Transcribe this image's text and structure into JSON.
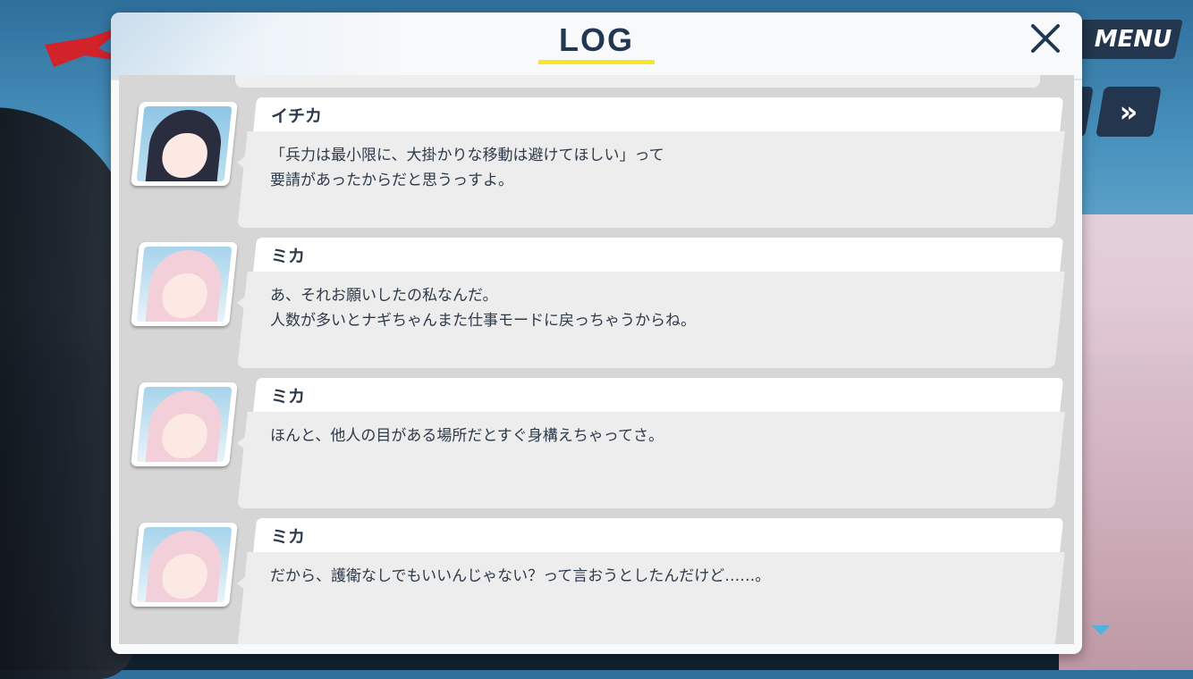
{
  "dialog": {
    "title": "LOG"
  },
  "hud": {
    "menu_label": "MENU",
    "fast_forward_label": "»"
  },
  "entries": [
    {
      "speaker": "イチカ",
      "avatar": "ichika-portrait",
      "text": "「兵力は最小限に、大掛かりな移動は避けてほしい」って\n要請があったからだと思うっすよ。"
    },
    {
      "speaker": "ミカ",
      "avatar": "mika-portrait",
      "text": "あ、それお願いしたの私なんだ。\n人数が多いとナギちゃんまた仕事モードに戻っちゃうからね。"
    },
    {
      "speaker": "ミカ",
      "avatar": "mika-portrait",
      "text": "ほんと、他人の目がある場所だとすぐ身構えちゃってさ。"
    },
    {
      "speaker": "ミカ",
      "avatar": "mika-portrait",
      "text": "だから、護衛なしでもいいんじゃない？って言おうとしたんだけど……。"
    }
  ],
  "colors": {
    "title": "#223852",
    "underline": "#f7e62a",
    "panel": "#d6d6d6",
    "scroll_arrow": "#4fb1e0"
  }
}
